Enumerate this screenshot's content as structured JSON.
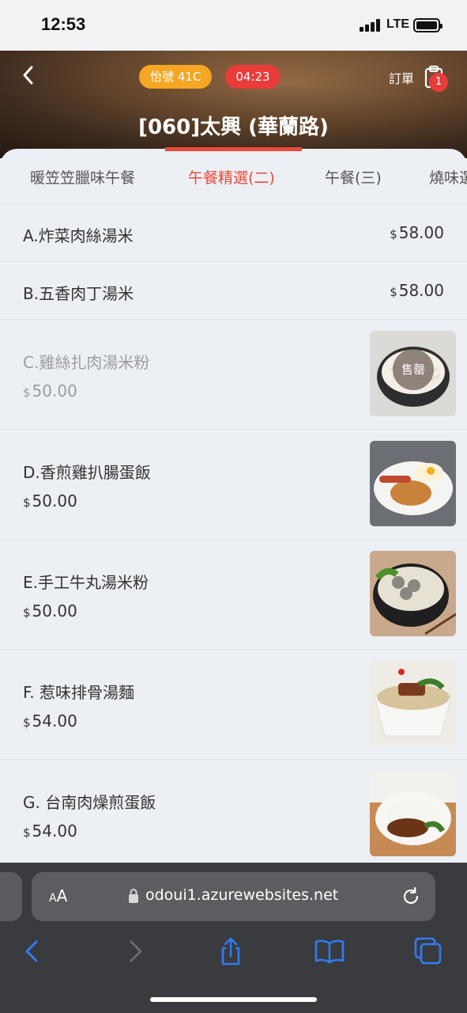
{
  "status_bar": {
    "time": "12:53",
    "network": "LTE"
  },
  "header": {
    "number_badge": "怡號 41C",
    "timer": "04:23",
    "order_label": "訂單",
    "order_count": "1",
    "store_title": "[060]太興 (華蘭路)"
  },
  "tabs": [
    "暖笠笠臘味午餐",
    "午餐精選(二)",
    "午餐(三)",
    "燒味選"
  ],
  "active_tab": 1,
  "currency": "$",
  "sold_out_label": "售罄",
  "items": [
    {
      "name": "A.炸菜肉絲湯米",
      "price": "58.00"
    },
    {
      "name": "B.五香肉丁湯米",
      "price": "58.00"
    },
    {
      "name": "C.雞絲扎肉湯米粉",
      "price": "50.00",
      "image": "noodle-soup-image",
      "sold_out": true
    },
    {
      "name": "D.香煎雞扒腸蛋飯",
      "price": "50.00",
      "image": "chicken-sausage-egg-image"
    },
    {
      "name": "E.手工牛丸湯米粉",
      "price": "50.00",
      "image": "beef-ball-noodle-image"
    },
    {
      "name": "F. 惹味排骨湯麵",
      "price": "54.00",
      "image": "pork-rib-noodle-image"
    },
    {
      "name": "G. 台南肉燥煎蛋飯",
      "price": "54.00",
      "image": "minced-pork-rice-image"
    }
  ],
  "browser": {
    "aa_small": "A",
    "aa_large": "A",
    "url": "odoui1.azurewebsites.net"
  },
  "colors": {
    "accent": "#e84b3c",
    "badge_orange": "#f5a623",
    "badge_red": "#ea3b3b",
    "ios_blue": "#2f7cf6"
  }
}
